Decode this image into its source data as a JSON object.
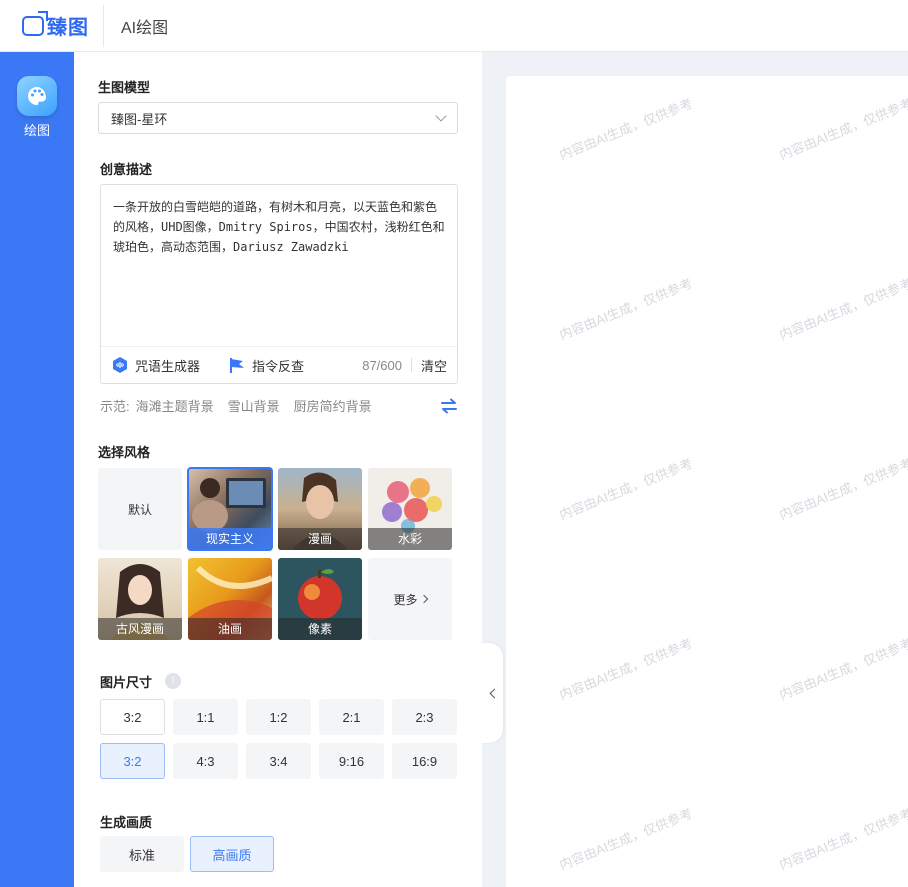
{
  "header": {
    "logo_text": "臻图",
    "title": "AI绘图"
  },
  "rail": {
    "items": [
      {
        "label": "绘图",
        "icon": "palette-icon",
        "active": true
      }
    ]
  },
  "model": {
    "section_title": "生图模型",
    "selected": "臻图-星环"
  },
  "prompt": {
    "section_title": "创意描述",
    "text": "一条开放的白雪皑皑的道路，有树木和月亮，以天蓝色和紫色的风格，UHD图像，Dmitry Spiros，中国农村，浅粉红色和琥珀色，高动态范围，Dariusz Zawadzki",
    "spell_generator_label": "咒语生成器",
    "reverse_lookup_label": "指令反查",
    "counter": "87/600",
    "clear_label": "清空"
  },
  "examples": {
    "prefix": "示范:",
    "items": [
      "海滩主题背景",
      "雪山背景",
      "厨房简约背景"
    ]
  },
  "styles": {
    "section_title": "选择风格",
    "items": [
      {
        "label": "默认",
        "kind": "plain",
        "selected": false
      },
      {
        "label": "现实主义",
        "kind": "image",
        "selected": true
      },
      {
        "label": "漫画",
        "kind": "image",
        "selected": false
      },
      {
        "label": "水彩",
        "kind": "image",
        "selected": false
      },
      {
        "label": "古风漫画",
        "kind": "image",
        "selected": false
      },
      {
        "label": "油画",
        "kind": "image",
        "selected": false
      },
      {
        "label": "像素",
        "kind": "image",
        "selected": false
      },
      {
        "label": "更多",
        "kind": "more",
        "selected": false
      }
    ]
  },
  "size": {
    "section_title": "图片尺寸",
    "row1": [
      "3:2",
      "1:1",
      "1:2",
      "2:1",
      "2:3"
    ],
    "row2": [
      "3:2",
      "4:3",
      "3:4",
      "9:16",
      "16:9"
    ]
  },
  "quality": {
    "section_title": "生成画质",
    "options": [
      "标准",
      "高画质"
    ],
    "selected": "高画质"
  },
  "canvas": {
    "watermark": "内容由AI生成，仅供参考"
  },
  "colors": {
    "brand": "#3b78f5",
    "rail": "#3b78f5",
    "active_bg": "#e9f0fe"
  }
}
